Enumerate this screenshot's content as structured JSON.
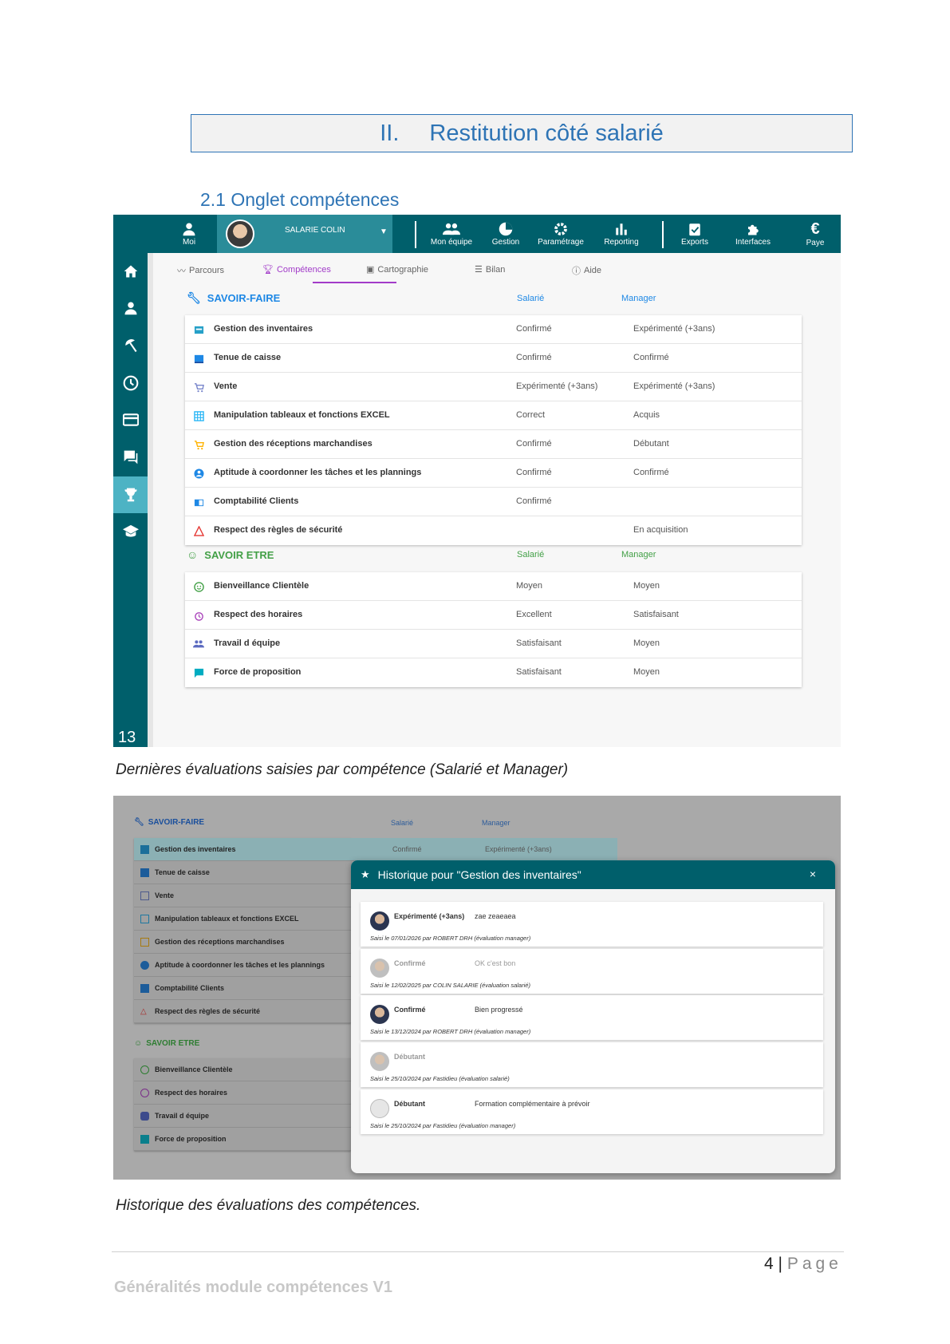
{
  "heading": {
    "number": "II.",
    "title": "Restitution côté salarié"
  },
  "subheading": "2.1 Onglet compétences",
  "app": {
    "topbar": {
      "moi": "Moi",
      "user_name": "SALARIE COLIN",
      "items": [
        "Mon équipe",
        "Gestion",
        "Paramétrage",
        "Reporting",
        "Exports",
        "Interfaces",
        "Paye"
      ]
    },
    "sidebar_page_number": "13",
    "tabs": [
      "Parcours",
      "Compétences",
      "Cartographie",
      "Bilan",
      "Aide"
    ],
    "active_tab": "Compétences",
    "savoir_faire": {
      "title": "SAVOIR-FAIRE",
      "col_salarie": "Salarié",
      "col_manager": "Manager",
      "rows": [
        {
          "name": "Gestion des inventaires",
          "salarie": "Confirmé",
          "manager": "Expérimenté (+3ans)",
          "icon": "inventory-icon"
        },
        {
          "name": "Tenue de caisse",
          "salarie": "Confirmé",
          "manager": "Confirmé",
          "icon": "cash-register-icon"
        },
        {
          "name": "Vente",
          "salarie": "Expérimenté (+3ans)",
          "manager": "Expérimenté (+3ans)",
          "icon": "cart-icon"
        },
        {
          "name": "Manipulation tableaux et fonctions EXCEL",
          "salarie": "Correct",
          "manager": "Acquis",
          "icon": "table-icon"
        },
        {
          "name": "Gestion des réceptions marchandises",
          "salarie": "Confirmé",
          "manager": "Débutant",
          "icon": "cart-icon"
        },
        {
          "name": "Aptitude à coordonner les tâches et les plannings",
          "salarie": "Confirmé",
          "manager": "Confirmé",
          "icon": "user-circle-icon"
        },
        {
          "name": "Comptabilité Clients",
          "salarie": "Confirmé",
          "manager": "",
          "icon": "book-icon"
        },
        {
          "name": "Respect des règles de sécurité",
          "salarie": "",
          "manager": "En acquisition",
          "icon": "warning-icon"
        }
      ]
    },
    "savoir_etre": {
      "title": "SAVOIR ETRE",
      "col_salarie": "Salarié",
      "col_manager": "Manager",
      "rows": [
        {
          "name": "Bienveillance Clientèle",
          "salarie": "Moyen",
          "manager": "Moyen",
          "icon": "smile-icon"
        },
        {
          "name": "Respect des horaires",
          "salarie": "Excellent",
          "manager": "Satisfaisant",
          "icon": "alarm-icon"
        },
        {
          "name": "Travail d équipe",
          "salarie": "Satisfaisant",
          "manager": "Moyen",
          "icon": "group-icon"
        },
        {
          "name": "Force de proposition",
          "salarie": "Satisfaisant",
          "manager": "Moyen",
          "icon": "chat-icon"
        }
      ]
    }
  },
  "caption1": "Dernières évaluations saisies par compétence (Salarié et Manager)",
  "modal": {
    "title": "Historique pour \"Gestion des inventaires\"",
    "close": "×",
    "entries": [
      {
        "level": "Expérimenté (+3ans)",
        "comment": "zae zeaeaea",
        "meta": "Saisi le 07/01/2026 par ROBERT DRH (évaluation manager)",
        "faded": false
      },
      {
        "level": "Confirmé",
        "comment": "OK c'est bon",
        "meta": "Saisi le 12/02/2025 par COLIN SALARIE (évaluation salarié)",
        "faded": true
      },
      {
        "level": "Confirmé",
        "comment": "Bien progressé",
        "meta": "Saisi le 13/12/2024 par ROBERT DRH (évaluation manager)",
        "faded": false
      },
      {
        "level": "Débutant",
        "comment": "",
        "meta": "Saisi le 25/10/2024 par Fastidieu (évaluation salarié)",
        "faded": true
      },
      {
        "level": "Débutant",
        "comment": "Formation complémentaire à prévoir",
        "meta": "Saisi le 25/10/2024 par Fastidieu (évaluation manager)",
        "faded": false
      }
    ]
  },
  "caption2": "Historique des évaluations des compétences.",
  "footer": {
    "page_number": "4",
    "page_label": "Page",
    "doc_title": "Généralités module compétences V1"
  },
  "colors": {
    "teal": "#005f6b",
    "accent": "#4db3c4",
    "purple": "#a23cc9",
    "blue": "#2e74b5",
    "green": "#43a047"
  }
}
